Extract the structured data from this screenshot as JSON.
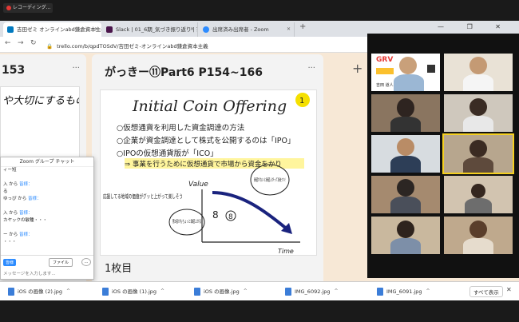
{
  "recording": {
    "label": "レコーディング..."
  },
  "tabs": [
    {
      "label": "吉田ゼミ オンラインabd鎌倉資本主義",
      "color": "#0079bf"
    },
    {
      "label": "Slack | 01_6期_気づき振り返り | 吉",
      "color": "#4a154b"
    },
    {
      "label": "出席済み出席者 - Zoom",
      "color": "#2d8cff"
    }
  ],
  "window_controls": "— ❐ ✕",
  "address": {
    "url": "trello.com/b/qpdTOSdV/吉田ゼミ-オンラインabd鎌倉資本主義"
  },
  "board": {
    "left_card": {
      "title": "153",
      "handwriting": "や大切にするもの"
    },
    "main_card": {
      "title": "がっきー⑪Part6 P154~166",
      "footer": "1枚目",
      "notes": {
        "heading": "Initial Coin Offering",
        "num": "1",
        "line1": "○仮想通貨を利用した資金調達の方法",
        "line2": "○企業が資金調達として株式を公開するのは「IPO」",
        "line3": "○IPOの仮想通貨版が「ICO」",
        "line4": "⇒ 事業を行うために仮想通貨で市場から資金をかり",
        "value_axis": "Value",
        "time_axis": "Time",
        "left_note": "応援してる地域の価値がグッと上がって楽しそう",
        "left_circle": "第3者がもちょっと価値上がる",
        "right_circle": "価値がないと価値上がって損をすぐ",
        "mark": "8"
      }
    },
    "add_icon": "+"
  },
  "chat": {
    "title": "Zoom グループ チャット",
    "lines": [
      {
        "a": "ィー短"
      },
      {
        "a": ""
      },
      {
        "a": "入 から",
        "b": "皆様："
      },
      {
        "a": "る"
      },
      {
        "a": "ゆっぴ から",
        "b": "皆様："
      },
      {
        "a": ""
      },
      {
        "a": "入 から",
        "b": "皆様："
      },
      {
        "a": "カヤックの敏種・・・"
      },
      {
        "a": ""
      },
      {
        "a": "ー から",
        "b": "皆様："
      },
      {
        "a": "・・・"
      }
    ],
    "to_label": "皆様",
    "file_label": "ファイル",
    "more_label": "…",
    "input_placeholder": "メッセージを入力します..."
  },
  "downloads": [
    {
      "name": "iOS の画像 (2).jpg"
    },
    {
      "name": "iOS の画像 (1).jpg"
    },
    {
      "name": "iOS の画像.jpg"
    },
    {
      "name": "IMG_6092.jpg"
    },
    {
      "name": "IMG_6091.jpg"
    }
  ],
  "show_all": "すべて表示",
  "close": "✕",
  "gallery": {
    "first_tile": {
      "logo": "GRV",
      "caption": "吉田 道人"
    }
  }
}
